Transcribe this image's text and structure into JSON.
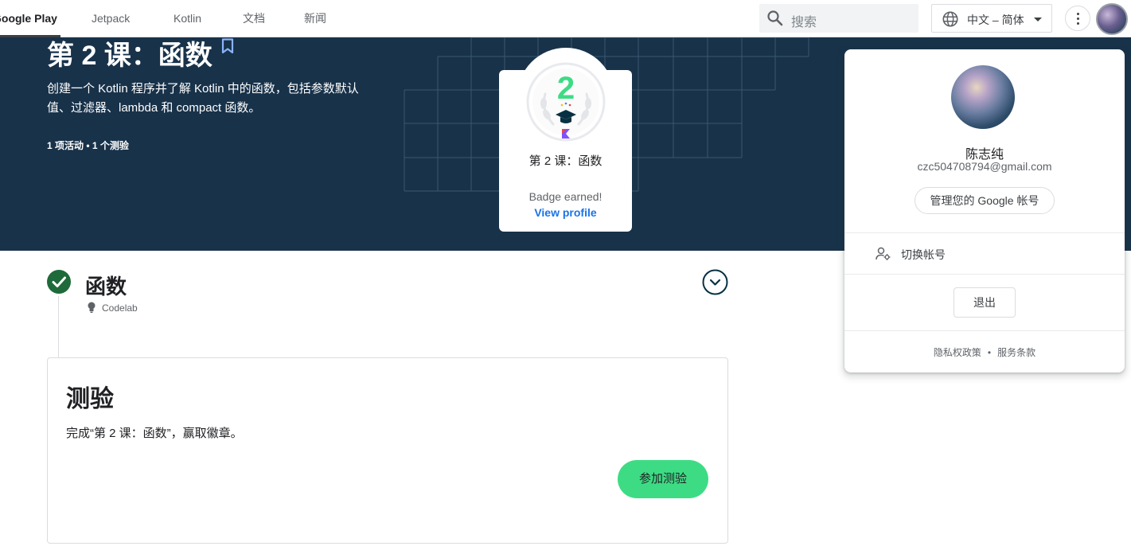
{
  "nav": {
    "tabs": [
      {
        "label": "Google Play",
        "active": true
      },
      {
        "label": "Jetpack",
        "active": false
      },
      {
        "label": "Kotlin",
        "active": false
      },
      {
        "label": "文档",
        "active": false
      },
      {
        "label": "新闻",
        "active": false
      }
    ],
    "search_placeholder": "搜索",
    "language": "中文 – 简体"
  },
  "hero": {
    "title": "第 2 课：函数",
    "description": "创建一个 Kotlin 程序并了解 Kotlin 中的函数，包括参数默认值、过滤器、lambda 和 compact 函数。",
    "meta": "1 项活动 • 1 个测验"
  },
  "badge": {
    "number": "2",
    "title": "第 2 课：函数",
    "earned": "Badge earned!",
    "link": "View profile"
  },
  "activity": {
    "title": "函数",
    "type": "Codelab"
  },
  "quiz": {
    "title": "测验",
    "description": "完成“第 2 课：函数”，赢取徽章。",
    "button": "参加测验"
  },
  "account": {
    "name": "陈志纯",
    "email": "czc504708794@gmail.com",
    "manage": "管理您的 Google 帐号",
    "switch": "切换帐号",
    "signout": "退出",
    "privacy": "隐私权政策",
    "separator": "•",
    "terms": "服务条款"
  },
  "colors": {
    "hero_bg": "#18324a",
    "quiz_button": "#3ddc84",
    "link": "#1a73e8",
    "check": "#1e6a3a"
  }
}
